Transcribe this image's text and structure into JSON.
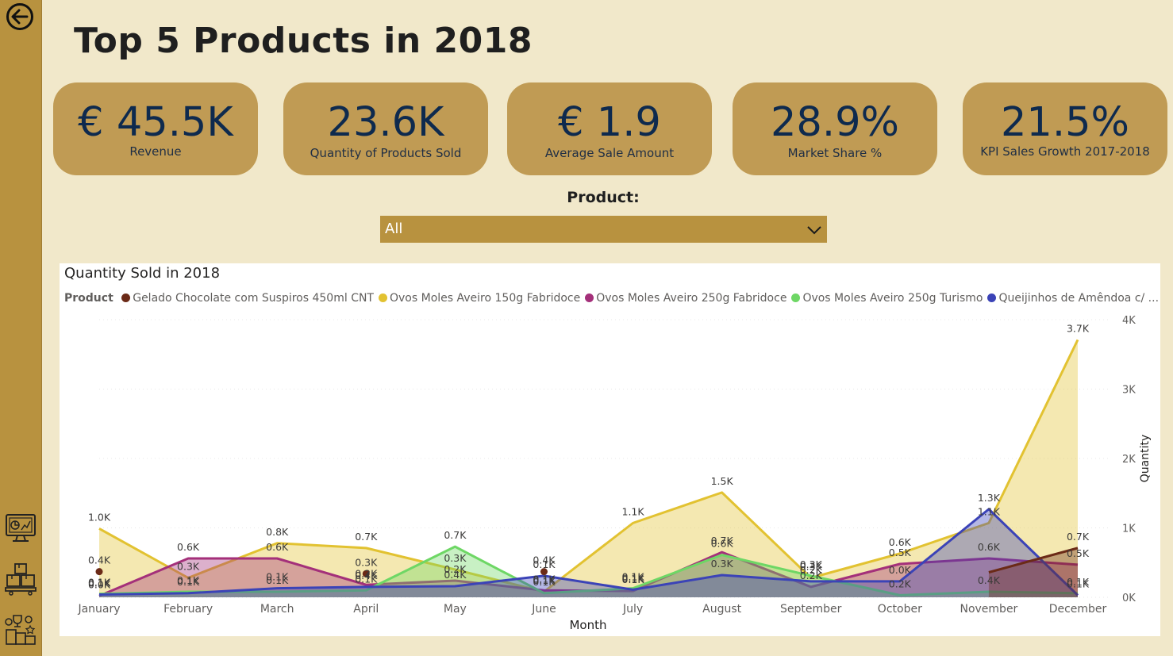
{
  "page": {
    "title": "Top 5 Products in 2018"
  },
  "sidebar": {
    "back_icon": "back-arrow-icon",
    "items": [
      {
        "name": "dashboard-icon"
      },
      {
        "name": "products-boxes-icon"
      },
      {
        "name": "top-products-trophy-icon"
      }
    ]
  },
  "kpis": [
    {
      "value": "€ 45.5K",
      "label": "Revenue"
    },
    {
      "value": "23.6K",
      "label": "Quantity of Products Sold"
    },
    {
      "value": "€ 1.9",
      "label": "Average Sale Amount"
    },
    {
      "value": "28.9%",
      "label": "Market Share %"
    },
    {
      "value": "21.5%",
      "label": "KPI Sales Growth 2017-2018"
    }
  ],
  "filter": {
    "label": "Product:",
    "value": "All"
  },
  "colors": {
    "sidebar": "#b8923f",
    "background": "#f1e8ca",
    "kpi_card": "#c09b54",
    "kpi_text": "#0e2a4e"
  },
  "chart_data": {
    "type": "area",
    "title": "Quantity Sold in 2018",
    "legend_title": "Product",
    "legend_position": "top-left",
    "xlabel": "Month",
    "ylabel": "Quantity",
    "y_axis_side": "right",
    "ylim": [
      0,
      4000
    ],
    "yticks": [
      0,
      1000,
      2000,
      3000,
      4000
    ],
    "ytick_labels": [
      "0K",
      "1K",
      "2K",
      "3K",
      "4K"
    ],
    "grid": true,
    "categories": [
      "January",
      "February",
      "March",
      "April",
      "May",
      "June",
      "July",
      "August",
      "September",
      "October",
      "November",
      "December"
    ],
    "series": [
      {
        "name": "Gelado Chocolate com Suspiros 450ml CNT",
        "color": "#6b2a17",
        "values": [
          370,
          null,
          null,
          340,
          null,
          370,
          null,
          null,
          null,
          null,
          360,
          710
        ],
        "labels": [
          "0.4K",
          "",
          "",
          "0.3K",
          "",
          "0.4K",
          "",
          "",
          "",
          "",
          "",
          "0.7K"
        ]
      },
      {
        "name": "Ovos Moles Aveiro 150g Fabridoce",
        "color": "#e2c231",
        "values": [
          990,
          280,
          780,
          710,
          400,
          80,
          1070,
          1510,
          280,
          630,
          1070,
          3710
        ],
        "labels": [
          "1.0K",
          "0.3K",
          "0.8K",
          "0.7K",
          "0.3K",
          "0.1K",
          "1.1K",
          "1.5K",
          "0.3K",
          "0.6K",
          "1.1K",
          "3.7K"
        ]
      },
      {
        "name": "Ovos Moles Aveiro 250g Fabridoce",
        "color": "#a4307a",
        "values": [
          20,
          560,
          560,
          180,
          240,
          100,
          90,
          650,
          150,
          480,
          560,
          470
        ],
        "labels": [
          "0.0K",
          "0.6K",
          "0.6K",
          "0.2K",
          "0.2K",
          "0.1K",
          "0.1K",
          "0.7K",
          "0.2K",
          "0.5K",
          "0.6K",
          "0.5K"
        ]
      },
      {
        "name": "Ovos Moles Aveiro 250g Turismo",
        "color": "#6ed765",
        "values": [
          50,
          80,
          80,
          100,
          730,
          60,
          130,
          610,
          310,
          30,
          80,
          60
        ],
        "labels": [
          "0.1K",
          "0.1K",
          "0.1K",
          "0.1K",
          "0.7K",
          "0.1K",
          "0.1K",
          "0.6K",
          "0.3K",
          "0.2K",
          "0.4K",
          "0.1K"
        ]
      },
      {
        "name": "Queijinhos de Amêndoa c/ ...",
        "color": "#3b43b7",
        "values": [
          40,
          60,
          130,
          150,
          160,
          310,
          110,
          320,
          230,
          230,
          1270,
          30
        ],
        "labels": [
          "0.1K",
          "0.1K",
          "0.1K",
          "0.4K",
          "0.4K",
          "0.1K",
          "0.1K",
          "0.3K",
          "0.2K",
          "0.0K",
          "1.3K",
          "0.1K"
        ]
      }
    ]
  }
}
